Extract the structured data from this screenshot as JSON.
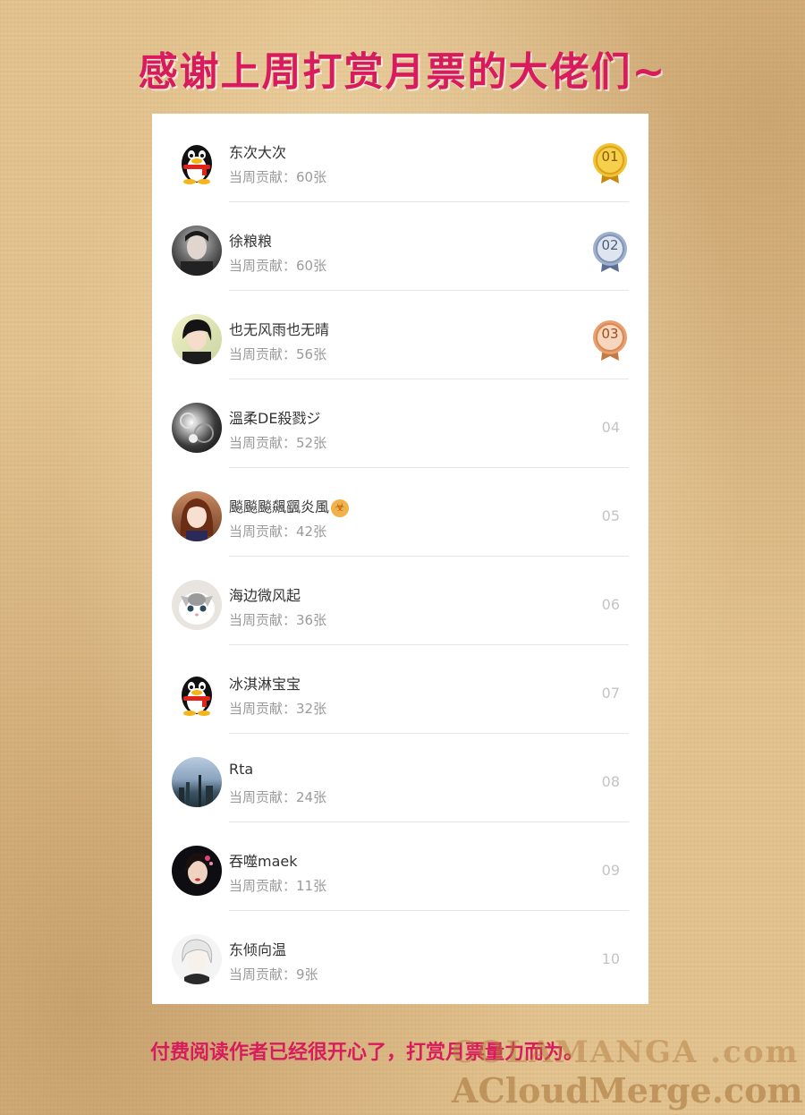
{
  "header": {
    "title": "感谢上周打赏月票的大佬们~"
  },
  "colors": {
    "title": "#d81b5c",
    "gold": "#e0a91e",
    "silver": "#8a9bb8",
    "bronze": "#d98850",
    "footer": "#d81b5c"
  },
  "ranking": {
    "rows": [
      {
        "name": "东次大次",
        "contribution": "当周贡献：60张",
        "rank": "01",
        "medal": "gold",
        "avatar": "qq-penguin-icon"
      },
      {
        "name": "徐粮粮",
        "contribution": "当周贡献：60张",
        "rank": "02",
        "medal": "silver",
        "avatar": "portrait-man"
      },
      {
        "name": "也无风雨也无晴",
        "contribution": "当周贡献：56张",
        "rank": "03",
        "medal": "bronze",
        "avatar": "anime-boy"
      },
      {
        "name": "溫柔DE殺戮ジ",
        "contribution": "当周贡献：52张",
        "rank": "04",
        "medal": "",
        "avatar": "dark-pattern"
      },
      {
        "name": "飈飈飈飆颻炎風",
        "contribution": "当周贡献：42张",
        "rank": "05",
        "medal": "",
        "avatar": "anime-girl"
      },
      {
        "name": "海边微风起",
        "contribution": "当周贡献：36张",
        "rank": "06",
        "medal": "",
        "avatar": "kitten"
      },
      {
        "name": "冰淇淋宝宝",
        "contribution": "当周贡献：32张",
        "rank": "07",
        "medal": "",
        "avatar": "qq-penguin-icon"
      },
      {
        "name": "Rta",
        "contribution": "当周贡献：24张",
        "rank": "08",
        "medal": "",
        "avatar": "city-skyline"
      },
      {
        "name": "吞噬maek",
        "contribution": "当周贡献：11张",
        "rank": "09",
        "medal": "",
        "avatar": "woman-portrait"
      },
      {
        "name": "东倾向温",
        "contribution": "当周贡献：9张",
        "rank": "10",
        "medal": "",
        "avatar": "white-hair-boy"
      }
    ]
  },
  "footer": {
    "text": "付费阅读作者已经很开心了，打赏月票量力而为。"
  },
  "watermark": {
    "line1": "COLAMANGA .com",
    "line2": "ACloudMerge.com"
  }
}
